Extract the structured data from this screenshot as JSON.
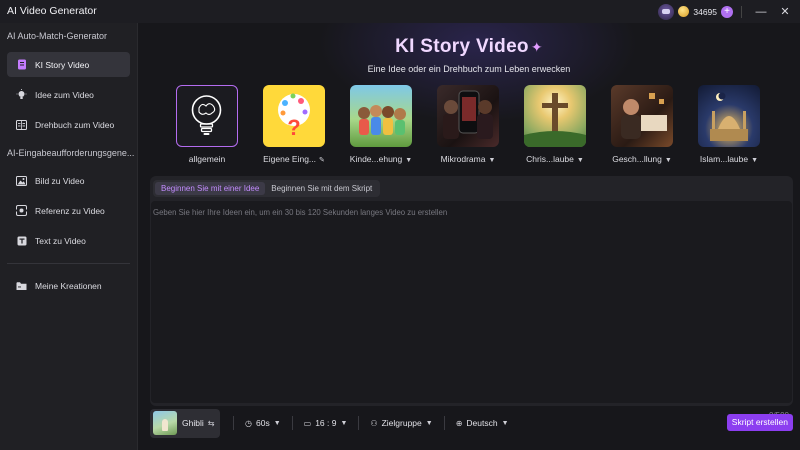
{
  "app": {
    "title": "AI Video Generator"
  },
  "titlebar": {
    "credits": "34695",
    "plus": "+",
    "minimize": "—",
    "close": "✕"
  },
  "sidebar": {
    "section1": "AI Auto-Match-Generator",
    "section2": "AI-Eingabeaufforderungsgene...",
    "items": [
      {
        "label": "KI Story Video",
        "icon": "story-icon"
      },
      {
        "label": "Idee zum Video",
        "icon": "bulb-icon"
      },
      {
        "label": "Drehbuch zum Video",
        "icon": "script-icon"
      },
      {
        "label": "Bild zu Video",
        "icon": "image-icon"
      },
      {
        "label": "Referenz zu Video",
        "icon": "reference-icon"
      },
      {
        "label": "Text zu Video",
        "icon": "text-icon"
      },
      {
        "label": "Meine Kreationen",
        "icon": "folder-icon"
      }
    ]
  },
  "hero": {
    "title": "KI Story Video",
    "subtitle": "Eine Idee oder ein Drehbuch zum Leben erwecken"
  },
  "cards": [
    {
      "label": "allgemein"
    },
    {
      "label": "Eigene Eing..."
    },
    {
      "label": "Kinde...ehung"
    },
    {
      "label": "Mikrodrama"
    },
    {
      "label": "Chris...laube"
    },
    {
      "label": "Gesch...llung"
    },
    {
      "label": "Islam...laube"
    }
  ],
  "editor": {
    "tab_idea": "Beginnen Sie mit einer Idee",
    "tab_script": "Beginnen Sie mit dem Skript",
    "placeholder": "Geben Sie hier Ihre Ideen ein, um ein 30 bis 120 Sekunden langes Video zu erstellen",
    "counter": "0/500"
  },
  "bottom": {
    "style": "Ghibli",
    "duration": "60s",
    "ratio": "16 : 9",
    "audience": "Zielgruppe",
    "language": "Deutsch",
    "create": "Skript erstellen"
  }
}
